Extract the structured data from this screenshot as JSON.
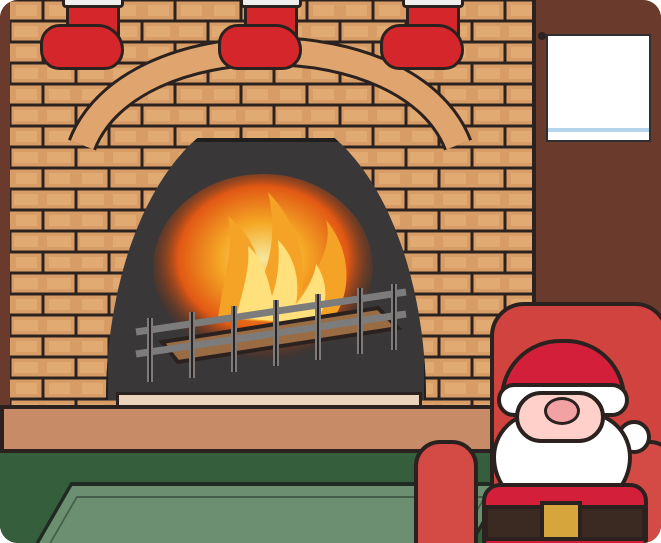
{
  "scene": {
    "stockings": [
      {
        "name": "left-stocking"
      },
      {
        "name": "middle-stocking"
      },
      {
        "name": "right-stocking"
      }
    ],
    "window_card": {
      "visible": true
    },
    "fire": {
      "state": "burning"
    }
  }
}
